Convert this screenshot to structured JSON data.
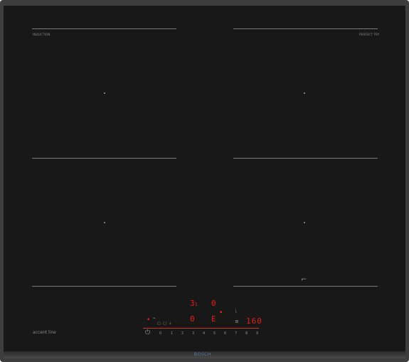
{
  "cooktop": {
    "brand_label": "accent line",
    "bottom_logo": "BOSCH",
    "zone_top_left_label": "INDUCTION",
    "zone_top_right_label": "PERFECT FRY",
    "display": {
      "top_left_value": "3",
      "top_left_sub": "1",
      "top_right_value": "0",
      "bottom_left_value": "0",
      "bottom_mid_value": "E",
      "temperature_value": "160"
    },
    "power_slider": {
      "values": [
        "0",
        "1",
        "2",
        "3",
        "4",
        "5",
        "6",
        "7",
        "8",
        "9"
      ]
    },
    "accent_color": "#e81d1d"
  }
}
